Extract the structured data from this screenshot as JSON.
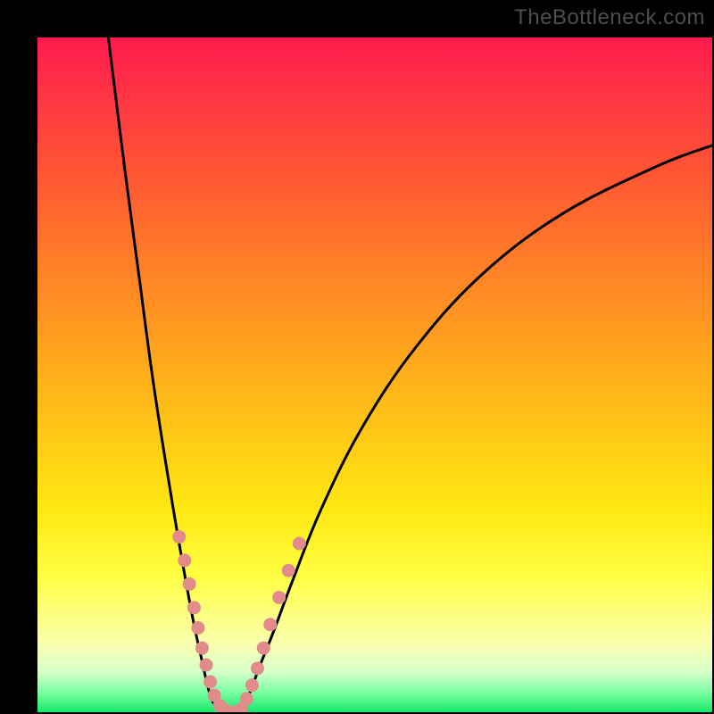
{
  "watermark": "TheBottleneck.com",
  "chart_data": {
    "type": "line",
    "title": "",
    "xlabel": "",
    "ylabel": "",
    "xlim": [
      0,
      100
    ],
    "ylim": [
      0,
      100
    ],
    "grid": false,
    "series": [
      {
        "name": "left-branch-curve",
        "color": "#000000",
        "x": [
          10.5,
          13,
          15,
          17,
          19,
          21,
          23,
          24.3,
          25.2,
          26,
          27.5
        ],
        "y": [
          100,
          80,
          65,
          50,
          37,
          25,
          14,
          8,
          4,
          1.5,
          0
        ]
      },
      {
        "name": "right-branch-curve",
        "color": "#000000",
        "x": [
          30,
          31.5,
          33,
          35,
          38,
          42,
          48,
          56,
          66,
          78,
          92,
          100
        ],
        "y": [
          0,
          3,
          7,
          12,
          20,
          30,
          42,
          54,
          65,
          74,
          81,
          84
        ]
      },
      {
        "name": "valley-flat",
        "color": "#e28b8b",
        "x": [
          27.5,
          30
        ],
        "y": [
          0,
          0
        ]
      }
    ],
    "markers": {
      "name": "highlight-dots",
      "color": "#e28b8b",
      "points": [
        {
          "x": 21.0,
          "y": 26.0
        },
        {
          "x": 21.8,
          "y": 22.5
        },
        {
          "x": 22.5,
          "y": 19.0
        },
        {
          "x": 23.2,
          "y": 15.5
        },
        {
          "x": 23.8,
          "y": 12.5
        },
        {
          "x": 24.4,
          "y": 9.5
        },
        {
          "x": 25.0,
          "y": 7.0
        },
        {
          "x": 25.6,
          "y": 4.5
        },
        {
          "x": 26.2,
          "y": 2.5
        },
        {
          "x": 27.0,
          "y": 1.0
        },
        {
          "x": 27.8,
          "y": 0.3
        },
        {
          "x": 28.6,
          "y": 0.0
        },
        {
          "x": 29.4,
          "y": 0.0
        },
        {
          "x": 30.2,
          "y": 0.5
        },
        {
          "x": 31.0,
          "y": 2.0
        },
        {
          "x": 31.8,
          "y": 4.0
        },
        {
          "x": 32.6,
          "y": 6.5
        },
        {
          "x": 33.5,
          "y": 9.5
        },
        {
          "x": 34.5,
          "y": 13.0
        },
        {
          "x": 35.8,
          "y": 17.0
        },
        {
          "x": 37.2,
          "y": 21.0
        },
        {
          "x": 38.8,
          "y": 25.0
        }
      ]
    }
  }
}
